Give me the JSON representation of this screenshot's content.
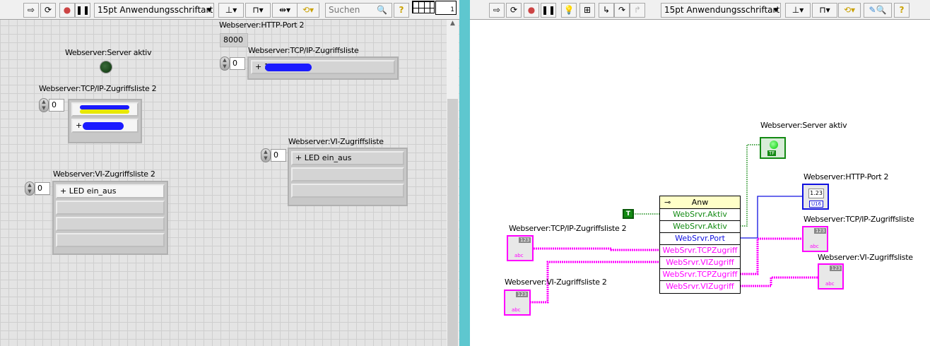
{
  "front_panel": {
    "toolbar": {
      "font": "15pt Anwendungsschriftart",
      "search_placeholder": "Suchen",
      "help": "?",
      "connector_num": "1"
    },
    "server_aktiv": {
      "label": "Webserver:Server aktiv",
      "state": false,
      "color": "#1e4a1e"
    },
    "http_port": {
      "label": "Webserver:HTTP-Port 2",
      "value": "8000"
    },
    "tcp_list": {
      "label": "Webserver:TCP/IP-Zugriffsliste",
      "index": "0",
      "items": [
        "+ 1"
      ]
    },
    "tcp_list2": {
      "label": "Webserver:TCP/IP-Zugriffsliste 2",
      "index": "0",
      "items": [
        "",
        "+ "
      ]
    },
    "vi_list": {
      "label": "Webserver:VI-Zugriffsliste",
      "index": "0",
      "items": [
        "+ LED ein_aus",
        "",
        ""
      ]
    },
    "vi_list2": {
      "label": "Webserver:VI-Zugriffsliste 2",
      "index": "0",
      "items": [
        "+ LED ein_aus",
        "",
        "",
        ""
      ]
    }
  },
  "block_diagram": {
    "toolbar": {
      "font": "15pt Anwendungsschriftart",
      "help": "?"
    },
    "true_const": "T",
    "node": {
      "title": "Anw",
      "rows": [
        {
          "label": "WebSrvr.Aktiv",
          "color": "#138a13"
        },
        {
          "label": "WebSrvr.Aktiv",
          "color": "#138a13"
        },
        {
          "label": "WebSrvr.Port",
          "color": "#1010e0"
        },
        {
          "label": "WebSrvr.TCPZugriff",
          "color": "#ff00ff"
        },
        {
          "label": "WebSrvr.VIZugriff",
          "color": "#ff00ff"
        },
        {
          "label": "WebSrvr.TCPZugriff",
          "color": "#ff00ff"
        },
        {
          "label": "WebSrvr.VIZugriff",
          "color": "#ff00ff"
        }
      ]
    },
    "terminals": {
      "server_aktiv": {
        "label": "Webserver:Server aktiv",
        "type": "TF"
      },
      "http_port": {
        "label": "Webserver:HTTP-Port 2",
        "type": "U16",
        "display": "1.23"
      },
      "tcp_list": {
        "label": "Webserver:TCP/IP-Zugriffsliste",
        "type": "abc"
      },
      "vi_list": {
        "label": "Webserver:VI-Zugriffsliste",
        "type": "abc"
      },
      "tcp_list2": {
        "label": "Webserver:TCP/IP-Zugriffsliste 2",
        "type": "abc"
      },
      "vi_list2": {
        "label": "Webserver:VI-Zugriffsliste 2",
        "type": "abc"
      }
    },
    "terminal_num": "123"
  }
}
